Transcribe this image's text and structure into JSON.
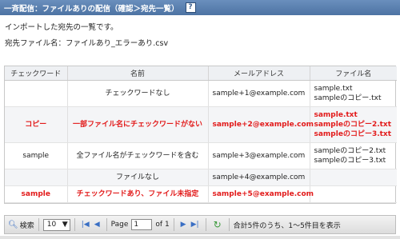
{
  "header": {
    "title": "一斉配信：ファイルありの配信（確認＞宛先一覧）",
    "help": "?"
  },
  "description": "インポートした宛先の一覧です。",
  "file": {
    "label": "宛先ファイル名：",
    "name": "ファイルあり_エラーあり.csv"
  },
  "table": {
    "columns": [
      "チェックワード",
      "名前",
      "メールアドレス",
      "ファイル名"
    ],
    "rows": [
      {
        "checkword": "",
        "name": "チェックワードなし",
        "email": "sample+1@example.com",
        "files": [
          "sample.txt",
          "sampleのコピー.txt"
        ],
        "error": false
      },
      {
        "checkword": "コピー",
        "name": "一部ファイル名にチェックワードがない",
        "email": "sample+2@example.com",
        "files": [
          "sample.txt",
          "sampleのコピー2.txt",
          "sampleのコピー3.txt"
        ],
        "error": true
      },
      {
        "checkword": "sample",
        "name": "全ファイル名がチェックワードを含む",
        "email": "sample+3@example.com",
        "files": [
          "sampleのコピー2.txt",
          "sampleのコピー3.txt"
        ],
        "error": false
      },
      {
        "checkword": "",
        "name": "ファイルなし",
        "email": "sample+4@example.com",
        "files": [],
        "error": false
      },
      {
        "checkword": "sample",
        "name": "チェックワードあり、ファイル未指定",
        "email": "sample+5@example.com",
        "files": [],
        "error": true
      }
    ]
  },
  "pager": {
    "search_label": "検索",
    "page_size": "10",
    "page_label": "Page",
    "current_page": "1",
    "of_label": "of 1",
    "summary": "合計5件のうち、1〜5件目を表示"
  },
  "colors": {
    "header_bg": "#4d73a3",
    "error": "#e21a1a"
  }
}
